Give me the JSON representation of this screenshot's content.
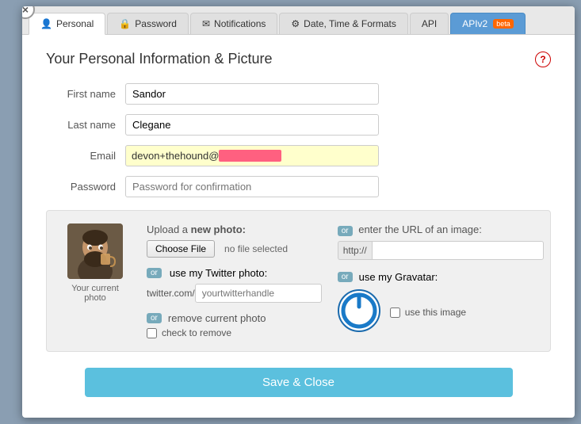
{
  "modal": {
    "title": "Your Personal Information & Picture"
  },
  "close_button": "×",
  "help_icon": "?",
  "tabs": [
    {
      "id": "personal",
      "label": "Personal",
      "icon": "👤",
      "active": true
    },
    {
      "id": "password",
      "label": "Password",
      "icon": "🔒",
      "active": false
    },
    {
      "id": "notifications",
      "label": "Notifications",
      "icon": "✉",
      "active": false
    },
    {
      "id": "date-time",
      "label": "Date, Time & Formats",
      "icon": "⚙",
      "active": false
    },
    {
      "id": "api",
      "label": "API",
      "icon": "",
      "active": false
    },
    {
      "id": "apiv2",
      "label": "APIv2",
      "badge": "beta",
      "active": false
    }
  ],
  "form": {
    "first_name_label": "First name",
    "first_name_value": "Sandor",
    "last_name_label": "Last name",
    "last_name_value": "Clegane",
    "email_label": "Email",
    "email_prefix": "devon+thehound@",
    "password_label": "Password",
    "password_placeholder": "Password for confirmation"
  },
  "photo_section": {
    "current_photo_label": "Your current\nphoto",
    "upload_label": "Upload a ",
    "upload_label_bold": "new photo:",
    "choose_file_label": "Choose File",
    "no_file_label": "no file selected",
    "or_twitter": "or",
    "twitter_label": "use my Twitter photo:",
    "twitter_prefix": "twitter.com/",
    "twitter_placeholder": "yourtwitterhandle",
    "or_remove": "or",
    "remove_label": "remove current photo",
    "check_remove_label": "check to remove",
    "or_url": "or",
    "url_label": "enter the URL of an image:",
    "url_prefix": "http://",
    "url_placeholder": "",
    "or_gravatar": "or",
    "gravatar_label": "use my Gravatar:",
    "use_this_image_label": "use this image"
  },
  "save_button": "Save & Close"
}
